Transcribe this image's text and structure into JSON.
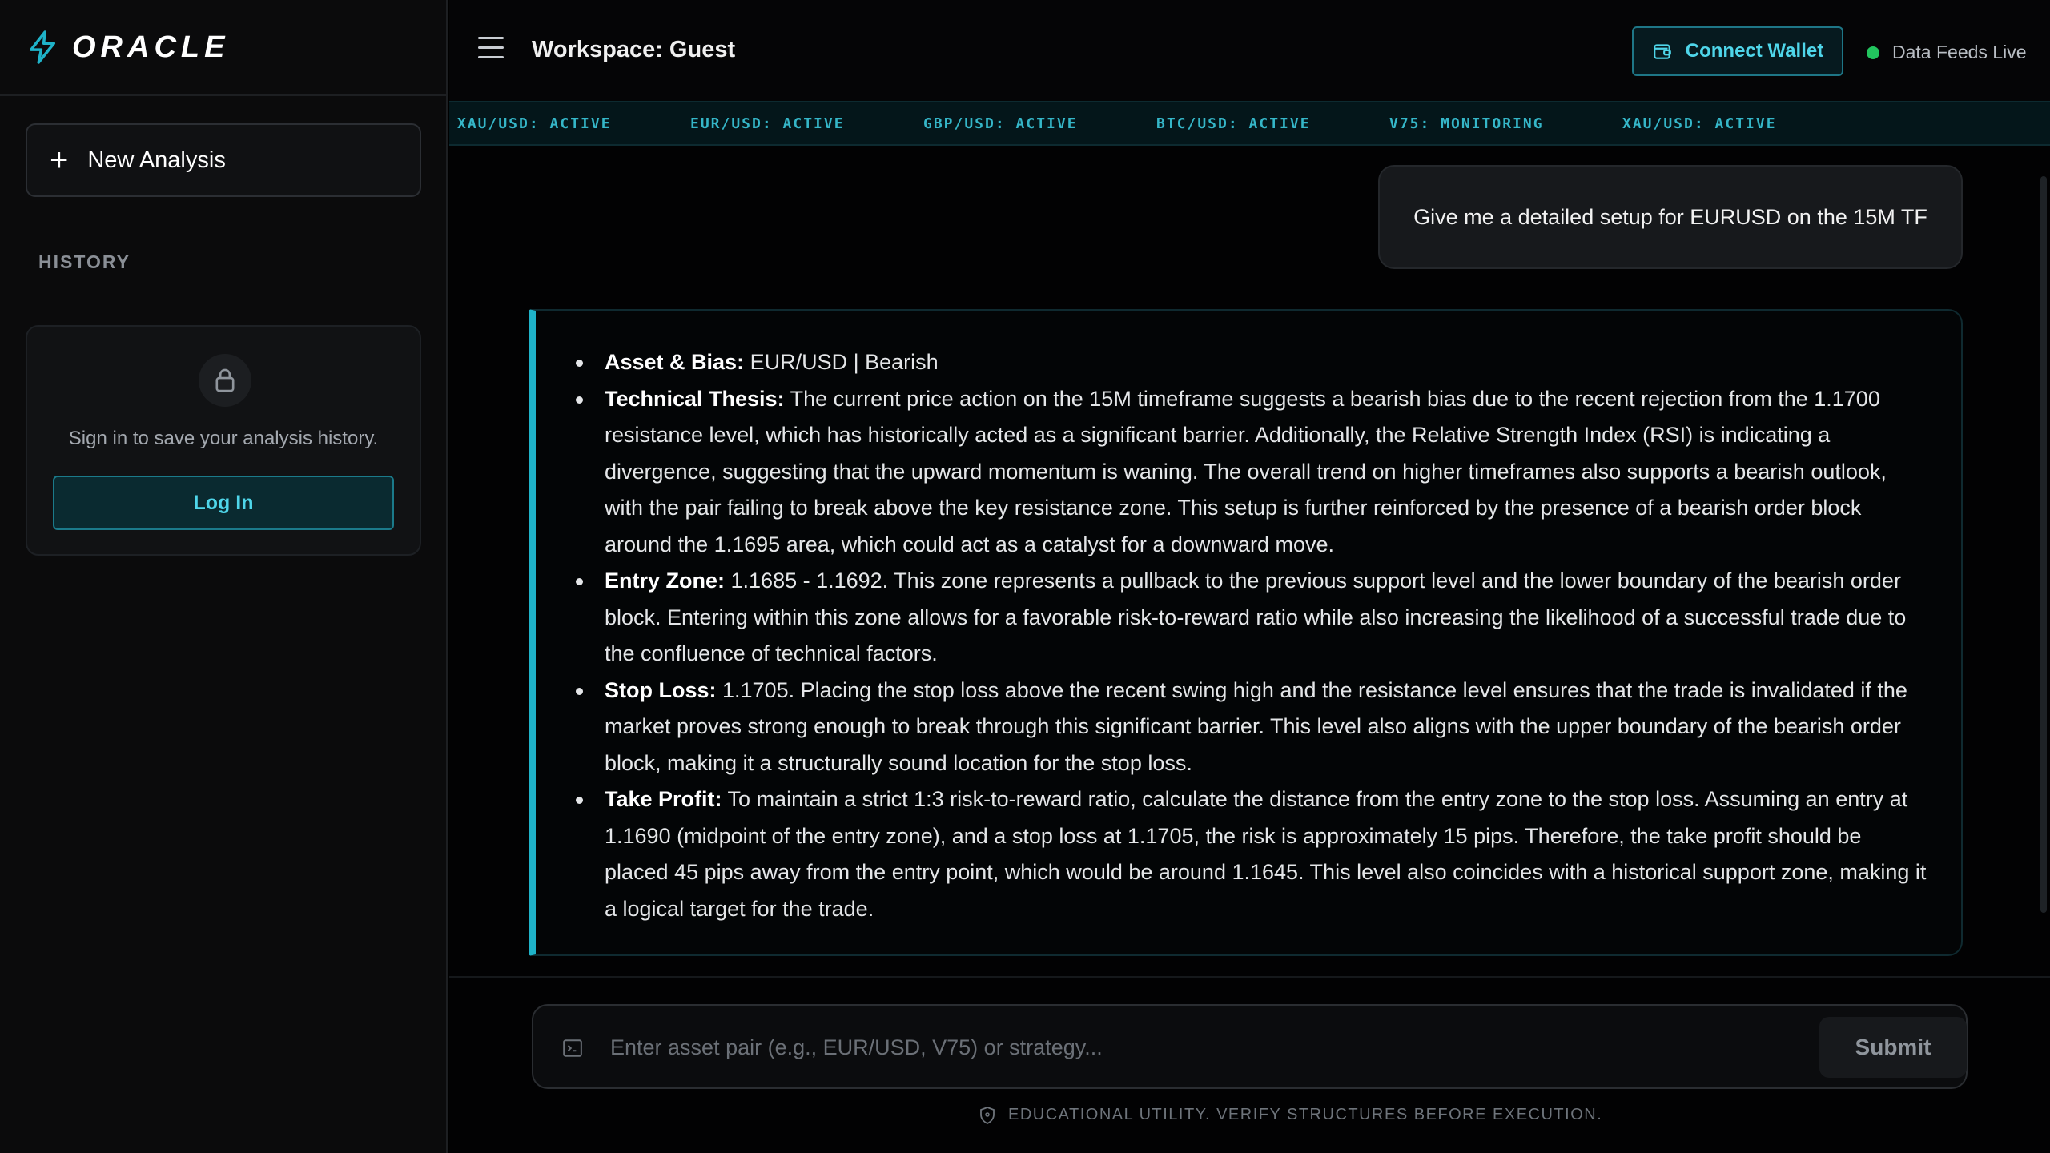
{
  "brand": {
    "name": "ORACLE",
    "accent": "#1fb3c9"
  },
  "sidebar": {
    "new_analysis_label": "New Analysis",
    "history_label": "HISTORY",
    "signin_message": "Sign in to save your analysis history.",
    "login_label": "Log In"
  },
  "header": {
    "workspace": "Workspace: Guest",
    "connect_wallet_label": "Connect Wallet",
    "status_label": "Data Feeds Live",
    "status_color": "#22c55e"
  },
  "ticker": [
    "XAU/USD: ACTIVE",
    "EUR/USD: ACTIVE",
    "GBP/USD: ACTIVE",
    "BTC/USD: ACTIVE",
    "V75: MONITORING",
    "XAU/USD: ACTIVE"
  ],
  "chat": {
    "user_message": "Give me a detailed setup for EURUSD on the 15M TF",
    "answer": [
      {
        "label": "Asset & Bias:",
        "text": " EUR/USD | Bearish"
      },
      {
        "label": "Technical Thesis:",
        "text": " The current price action on the 15M timeframe suggests a bearish bias due to the recent rejection from the 1.1700 resistance level, which has historically acted as a significant barrier. Additionally, the Relative Strength Index (RSI) is indicating a divergence, suggesting that the upward momentum is waning. The overall trend on higher timeframes also supports a bearish outlook, with the pair failing to break above the key resistance zone. This setup is further reinforced by the presence of a bearish order block around the 1.1695 area, which could act as a catalyst for a downward move."
      },
      {
        "label": "Entry Zone:",
        "text": " 1.1685 - 1.1692. This zone represents a pullback to the previous support level and the lower boundary of the bearish order block. Entering within this zone allows for a favorable risk-to-reward ratio while also increasing the likelihood of a successful trade due to the confluence of technical factors."
      },
      {
        "label": "Stop Loss:",
        "text": " 1.1705. Placing the stop loss above the recent swing high and the resistance level ensures that the trade is invalidated if the market proves strong enough to break through this significant barrier. This level also aligns with the upper boundary of the bearish order block, making it a structurally sound location for the stop loss."
      },
      {
        "label": "Take Profit:",
        "text": " To maintain a strict 1:3 risk-to-reward ratio, calculate the distance from the entry zone to the stop loss. Assuming an entry at 1.1690 (midpoint of the entry zone), and a stop loss at 1.1705, the risk is approximately 15 pips. Therefore, the take profit should be placed 45 pips away from the entry point, which would be around 1.1645. This level also coincides with a historical support zone, making it a logical target for the trade."
      }
    ]
  },
  "composer": {
    "placeholder": "Enter asset pair (e.g., EUR/USD, V75) or strategy...",
    "value": "",
    "submit_label": "Submit"
  },
  "footer": {
    "disclaimer": "EDUCATIONAL UTILITY. VERIFY STRUCTURES BEFORE EXECUTION."
  },
  "icons": [
    "bolt-icon",
    "plus-icon",
    "lock-icon",
    "menu-icon",
    "wallet-icon",
    "terminal-icon",
    "shield-icon"
  ]
}
